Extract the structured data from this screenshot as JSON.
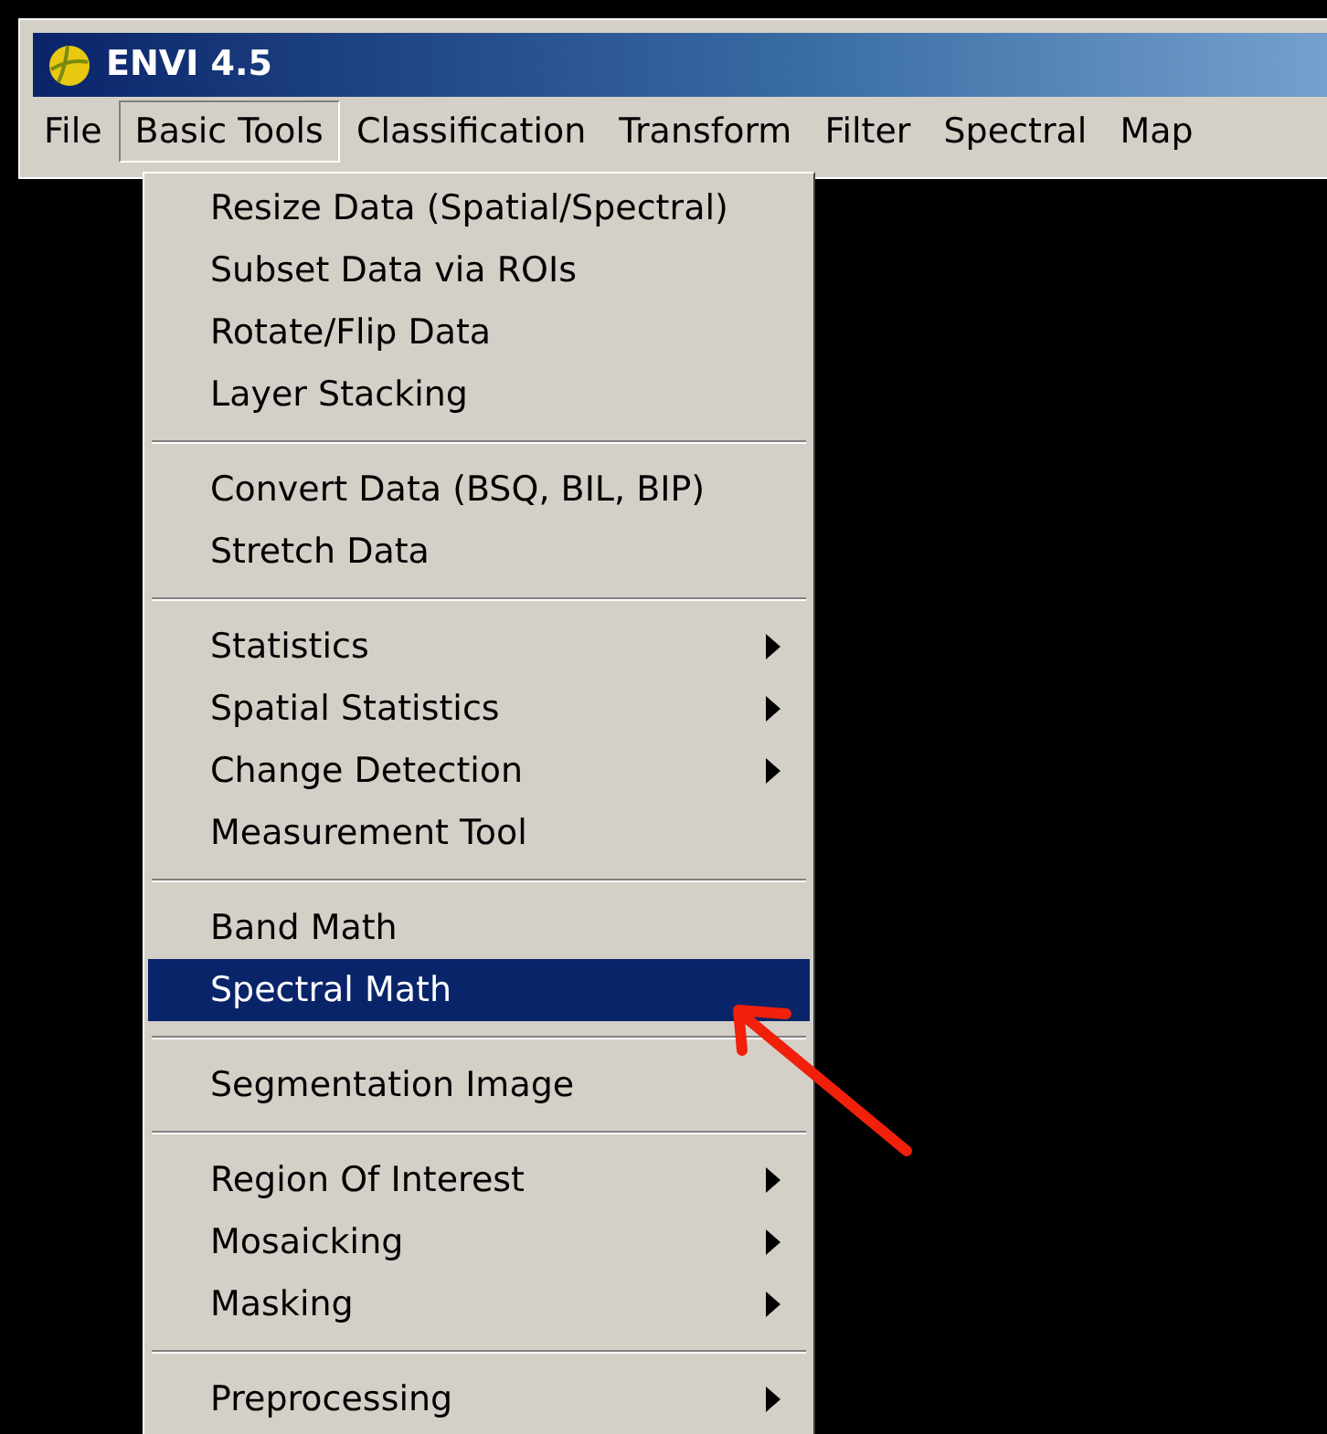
{
  "window": {
    "title": "ENVI 4.5"
  },
  "menu_bar": [
    {
      "label": "File",
      "selected": false
    },
    {
      "label": "Basic Tools",
      "selected": true
    },
    {
      "label": "Classification",
      "selected": false
    },
    {
      "label": "Transform",
      "selected": false
    },
    {
      "label": "Filter",
      "selected": false
    },
    {
      "label": "Spectral",
      "selected": false
    },
    {
      "label": "Map",
      "selected": false
    }
  ],
  "menu": {
    "items": [
      {
        "kind": "item",
        "label": "Resize Data (Spatial/Spectral)",
        "submenu": false,
        "selected": false
      },
      {
        "kind": "item",
        "label": "Subset Data via ROIs",
        "submenu": false,
        "selected": false
      },
      {
        "kind": "item",
        "label": "Rotate/Flip Data",
        "submenu": false,
        "selected": false
      },
      {
        "kind": "item",
        "label": "Layer Stacking",
        "submenu": false,
        "selected": false
      },
      {
        "kind": "separator"
      },
      {
        "kind": "item",
        "label": "Convert Data (BSQ, BIL, BIP)",
        "submenu": false,
        "selected": false
      },
      {
        "kind": "item",
        "label": "Stretch Data",
        "submenu": false,
        "selected": false
      },
      {
        "kind": "separator"
      },
      {
        "kind": "item",
        "label": "Statistics",
        "submenu": true,
        "selected": false
      },
      {
        "kind": "item",
        "label": "Spatial Statistics",
        "submenu": true,
        "selected": false
      },
      {
        "kind": "item",
        "label": "Change Detection",
        "submenu": true,
        "selected": false
      },
      {
        "kind": "item",
        "label": "Measurement Tool",
        "submenu": false,
        "selected": false
      },
      {
        "kind": "separator"
      },
      {
        "kind": "item",
        "label": "Band Math",
        "submenu": false,
        "selected": false
      },
      {
        "kind": "item",
        "label": "Spectral Math",
        "submenu": false,
        "selected": true
      },
      {
        "kind": "separator"
      },
      {
        "kind": "item",
        "label": "Segmentation Image",
        "submenu": false,
        "selected": false
      },
      {
        "kind": "separator"
      },
      {
        "kind": "item",
        "label": "Region Of Interest",
        "submenu": true,
        "selected": false
      },
      {
        "kind": "item",
        "label": "Mosaicking",
        "submenu": true,
        "selected": false
      },
      {
        "kind": "item",
        "label": "Masking",
        "submenu": true,
        "selected": false
      },
      {
        "kind": "separator"
      },
      {
        "kind": "item",
        "label": "Preprocessing",
        "submenu": true,
        "selected": false
      }
    ]
  }
}
